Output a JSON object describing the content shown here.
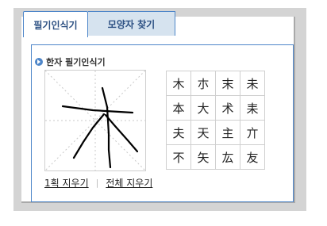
{
  "tabs": [
    {
      "label": "필기인식기",
      "active": true
    },
    {
      "label": "모양자 찾기",
      "active": false
    }
  ],
  "section_title": "한자 필기인식기",
  "candidates": [
    "木",
    "朩",
    "末",
    "未",
    "本",
    "大",
    "术",
    "耒",
    "夫",
    "天",
    "主",
    "亣",
    "不",
    "矢",
    "厷",
    "友"
  ],
  "links": {
    "undo_stroke": "1획 지우기",
    "clear_all": "전체 지우기"
  },
  "colors": {
    "accent": "#4e86c9",
    "tab_inactive_bg": "#d6e3ef",
    "frame_gray": "#d4d4d4"
  }
}
